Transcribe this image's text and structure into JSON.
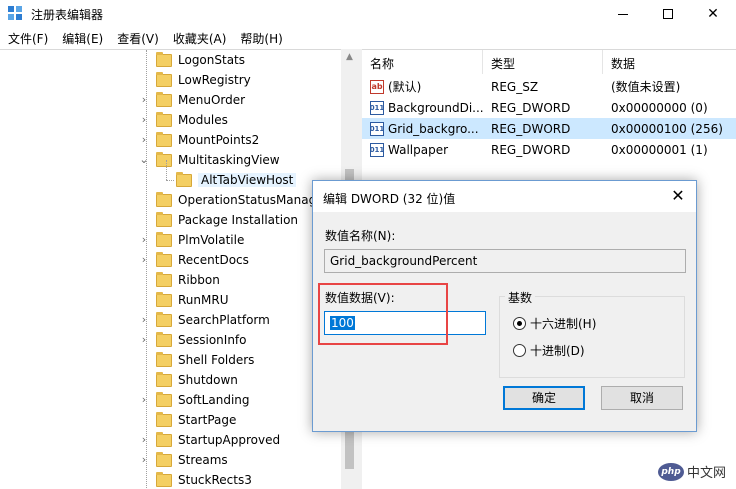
{
  "window": {
    "title": "注册表编辑器"
  },
  "menu": [
    "文件(F)",
    "编辑(E)",
    "查看(V)",
    "收藏夹(A)",
    "帮助(H)"
  ],
  "tree": {
    "items": [
      {
        "label": "LogonStats",
        "expandable": false
      },
      {
        "label": "LowRegistry",
        "expandable": false
      },
      {
        "label": "MenuOrder",
        "expandable": true
      },
      {
        "label": "Modules",
        "expandable": true
      },
      {
        "label": "MountPoints2",
        "expandable": true
      },
      {
        "label": "MultitaskingView",
        "expandable": true,
        "expanded": true
      },
      {
        "label": "AltTabViewHost",
        "expandable": false,
        "child": true,
        "selected": true
      },
      {
        "label": "OperationStatusManag",
        "expandable": false
      },
      {
        "label": "Package Installation",
        "expandable": false
      },
      {
        "label": "PlmVolatile",
        "expandable": true
      },
      {
        "label": "RecentDocs",
        "expandable": true
      },
      {
        "label": "Ribbon",
        "expandable": false
      },
      {
        "label": "RunMRU",
        "expandable": false
      },
      {
        "label": "SearchPlatform",
        "expandable": true
      },
      {
        "label": "SessionInfo",
        "expandable": true
      },
      {
        "label": "Shell Folders",
        "expandable": false
      },
      {
        "label": "Shutdown",
        "expandable": false
      },
      {
        "label": "SoftLanding",
        "expandable": true
      },
      {
        "label": "StartPage",
        "expandable": false
      },
      {
        "label": "StartupApproved",
        "expandable": true
      },
      {
        "label": "Streams",
        "expandable": true
      },
      {
        "label": "StuckRects3",
        "expandable": false
      }
    ]
  },
  "list": {
    "headers": {
      "name": "名称",
      "type": "类型",
      "data": "数据"
    },
    "rows": [
      {
        "icon": "string-value-icon",
        "name": "(默认)",
        "type": "REG_SZ",
        "data": "(数值未设置)"
      },
      {
        "icon": "binary-value-icon",
        "name": "BackgroundDi...",
        "type": "REG_DWORD",
        "data": "0x00000000 (0)"
      },
      {
        "icon": "binary-value-icon",
        "name": "Grid_backgro...",
        "type": "REG_DWORD",
        "data": "0x00000100 (256)",
        "selected": true
      },
      {
        "icon": "binary-value-icon",
        "name": "Wallpaper",
        "type": "REG_DWORD",
        "data": "0x00000001 (1)"
      }
    ]
  },
  "dialog": {
    "title": "编辑 DWORD (32 位)值",
    "name_label": "数值名称(N):",
    "name_value": "Grid_backgroundPercent",
    "data_label": "数值数据(V):",
    "data_value": "100",
    "base_label": "基数",
    "hex_label": "十六进制(H)",
    "dec_label": "十进制(D)",
    "selected_base": "hex",
    "ok_label": "确定",
    "cancel_label": "取消"
  },
  "watermark": {
    "badge": "php",
    "text": "中文网"
  },
  "colors": {
    "selection": "#cce8ff",
    "accent": "#0078d7",
    "highlight": "#e84545"
  }
}
